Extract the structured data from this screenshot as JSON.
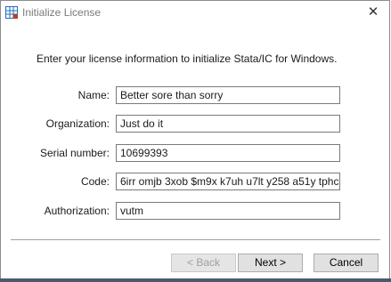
{
  "window": {
    "title": "Initialize License",
    "close_glyph": "✕"
  },
  "intro_text": "Enter your license information to initialize Stata/IC for Windows.",
  "fields": [
    {
      "label": "Name:",
      "value": "Better sore than sorry"
    },
    {
      "label": "Organization:",
      "value": "Just do it"
    },
    {
      "label": "Serial number:",
      "value": "10699393"
    },
    {
      "label": "Code:",
      "value": "6irr omjb 3xob $m9x k7uh u7lt y258 a51y tphc"
    },
    {
      "label": "Authorization:",
      "value": "vutm"
    }
  ],
  "buttons": {
    "back": "< Back",
    "next": "Next >",
    "cancel": "Cancel"
  },
  "colors": {
    "accent": "#1f6fb5",
    "icon_red": "#c0392b"
  }
}
